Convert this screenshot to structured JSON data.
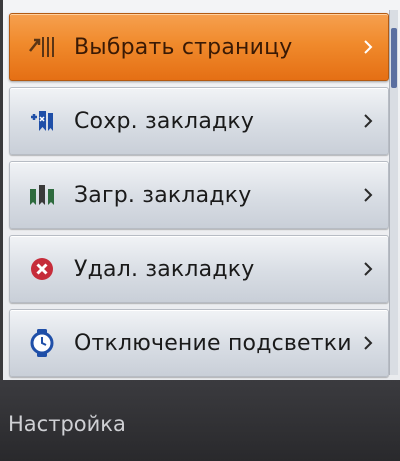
{
  "menu": {
    "items": [
      {
        "label": "Выбрать страницу",
        "icon": "goto-page-icon",
        "selected": true
      },
      {
        "label": "Сохр. закладку",
        "icon": "save-bookmark-icon",
        "selected": false
      },
      {
        "label": "Загр. закладку",
        "icon": "load-bookmark-icon",
        "selected": false
      },
      {
        "label": "Удал. закладку",
        "icon": "delete-bookmark-icon",
        "selected": false
      },
      {
        "label": "Отключение подсветки",
        "icon": "backlight-timer-icon",
        "selected": false
      }
    ],
    "chevron": "›"
  },
  "footer": {
    "title": "Настройка"
  },
  "colors": {
    "selected": "#f08a2c",
    "item": "#d8dde4",
    "footer": "#2f2f33",
    "icon_blue": "#1f4fa8",
    "icon_red": "#c62c3a"
  }
}
